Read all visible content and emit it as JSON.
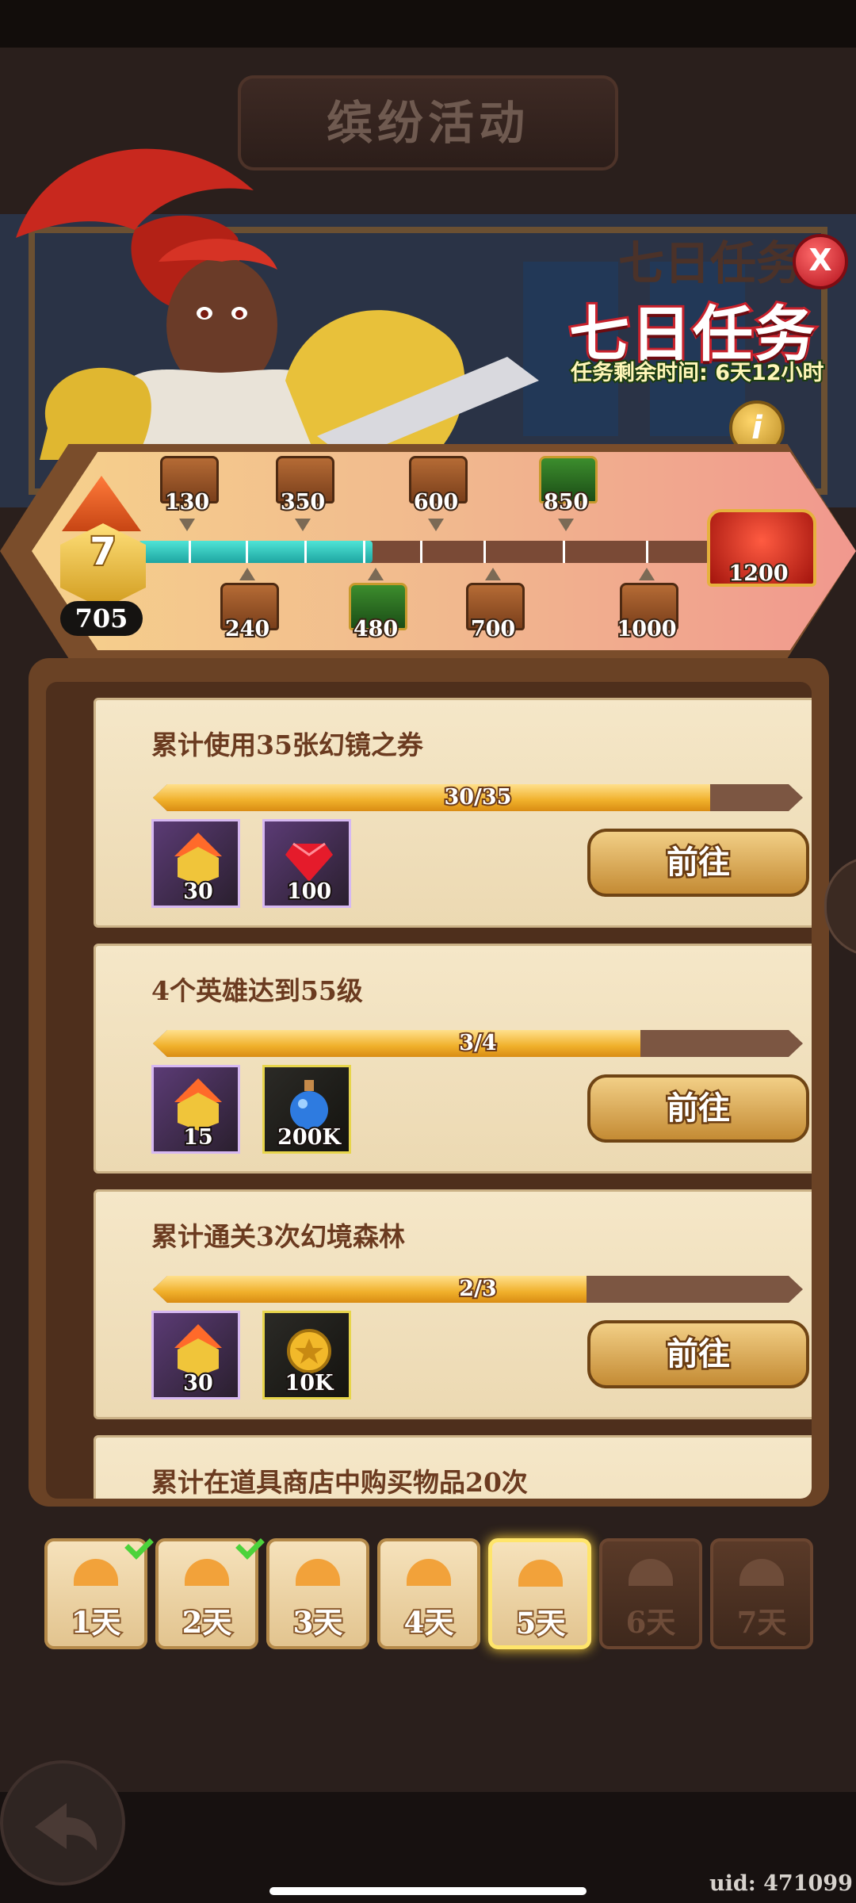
{
  "header": {
    "title": "缤纷活动"
  },
  "banner": {
    "title_shadow": "七日任务",
    "title": "七日任务",
    "remaining": "任务剩余时间: 6天12小时",
    "close_label": "X",
    "info_label": "i"
  },
  "milestones": {
    "level": "7",
    "points": "705",
    "progress_fraction": 0.41,
    "top": [
      {
        "label": "130",
        "style": "normal"
      },
      {
        "label": "350",
        "style": "normal"
      },
      {
        "label": "600",
        "style": "normal"
      },
      {
        "label": "850",
        "style": "green"
      }
    ],
    "bottom": [
      {
        "label": "240",
        "style": "normal"
      },
      {
        "label": "480",
        "style": "green"
      },
      {
        "label": "700",
        "style": "normal"
      },
      {
        "label": "1000",
        "style": "normal"
      }
    ],
    "final": "1200"
  },
  "tasks": [
    {
      "title": "累计使用35张幻镜之券",
      "progress_text": "30/35",
      "progress": 0.857,
      "rewards": [
        {
          "amount": "30",
          "icon": "level-badge-icon",
          "style": "purple"
        },
        {
          "amount": "100",
          "icon": "ruby-gem-icon",
          "style": "purple"
        }
      ],
      "button": "前往"
    },
    {
      "title": "4个英雄达到55级",
      "progress_text": "3/4",
      "progress": 0.75,
      "rewards": [
        {
          "amount": "15",
          "icon": "level-badge-icon",
          "style": "purple"
        },
        {
          "amount": "200K",
          "icon": "exp-potion-icon",
          "style": "gold"
        }
      ],
      "button": "前往"
    },
    {
      "title": "累计通关3次幻境森林",
      "progress_text": "2/3",
      "progress": 0.667,
      "rewards": [
        {
          "amount": "30",
          "icon": "level-badge-icon",
          "style": "purple"
        },
        {
          "amount": "10K",
          "icon": "gold-coin-icon",
          "style": "gold"
        }
      ],
      "button": "前往"
    },
    {
      "title": "累计在道具商店中购买物品20次"
    }
  ],
  "days": [
    {
      "label": "1天",
      "state": "completed"
    },
    {
      "label": "2天",
      "state": "completed"
    },
    {
      "label": "3天",
      "state": "open"
    },
    {
      "label": "4天",
      "state": "open"
    },
    {
      "label": "5天",
      "state": "selected"
    },
    {
      "label": "6天",
      "state": "locked"
    },
    {
      "label": "7天",
      "state": "locked"
    }
  ],
  "footer": {
    "uid": "uid: 471099"
  },
  "colors": {
    "accent_red": "#c7202b",
    "progress_teal": "#1ea5a1",
    "progress_gold": "#f0b02b",
    "check_green": "#4cd33b"
  }
}
